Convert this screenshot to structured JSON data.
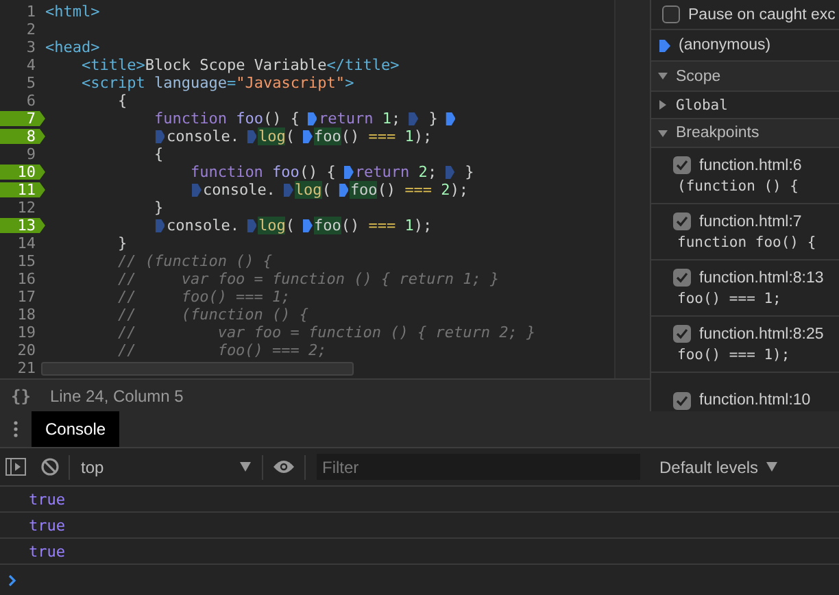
{
  "editor": {
    "lines": [
      {
        "number": "1",
        "breakpoint": false,
        "tokens": [
          {
            "kind": "tag",
            "text": "<html>"
          }
        ]
      },
      {
        "number": "2",
        "breakpoint": false
      },
      {
        "number": "3",
        "breakpoint": false,
        "tokens": [
          {
            "kind": "tag",
            "text": "<head>"
          }
        ],
        "children": [
          {
            "number": "4",
            "breakpoint": false,
            "tokens": [
              {
                "kind": "tag",
                "text": "<title>"
              },
              {
                "kind": "text",
                "text": "Block Scope Variable"
              },
              {
                "kind": "tag",
                "text": "</title>"
              }
            ]
          },
          {
            "number": "5",
            "breakpoint": false,
            "tokens": [
              {
                "kind": "tag",
                "text": "<script"
              },
              {
                "kind": "attr",
                "text": " language"
              },
              {
                "kind": "tag",
                "text": "="
              },
              {
                "kind": "string",
                "text": "\"Javascript\""
              },
              {
                "kind": "tag",
                "text": ">"
              }
            ],
            "children": [
              {
                "number": "6",
                "breakpoint": false,
                "tokens": [
                  {
                    "kind": "text",
                    "text": "{"
                  }
                ],
                "children": [
                  {
                    "number": "7",
                    "breakpoint": true,
                    "tokens": [
                      {
                        "kind": "keyword",
                        "text": "function"
                      },
                      {
                        "kind": "name",
                        "text": " foo"
                      },
                      {
                        "kind": "text",
                        "text": "() {"
                      },
                      {
                        "kind": "marker",
                        "active": true
                      },
                      {
                        "kind": "keyword",
                        "text": "return"
                      },
                      {
                        "kind": "number",
                        "text": " 1"
                      },
                      {
                        "kind": "text",
                        "text": ";"
                      },
                      {
                        "kind": "marker",
                        "active": false
                      },
                      {
                        "kind": "text",
                        "text": " }"
                      },
                      {
                        "kind": "marker",
                        "active": true
                      }
                    ]
                  },
                  {
                    "number": "8",
                    "breakpoint": true,
                    "tokens": [
                      {
                        "kind": "marker",
                        "active": false
                      },
                      {
                        "kind": "text",
                        "text": "console."
                      },
                      {
                        "kind": "marker",
                        "active": false
                      },
                      {
                        "kind": "method",
                        "text": "log",
                        "highlighted": true
                      },
                      {
                        "kind": "text",
                        "text": "("
                      },
                      {
                        "kind": "marker",
                        "active": true
                      },
                      {
                        "kind": "text",
                        "text": "foo",
                        "highlighted": true
                      },
                      {
                        "kind": "text",
                        "text": "() "
                      },
                      {
                        "kind": "operator",
                        "text": "==="
                      },
                      {
                        "kind": "number",
                        "text": " 1"
                      },
                      {
                        "kind": "text",
                        "text": ");"
                      }
                    ]
                  },
                  {
                    "number": "9",
                    "breakpoint": false,
                    "tokens": [
                      {
                        "kind": "text",
                        "text": "{"
                      }
                    ],
                    "children": [
                      {
                        "number": "10",
                        "breakpoint": true,
                        "tokens": [
                          {
                            "kind": "keyword",
                            "text": "function"
                          },
                          {
                            "kind": "name",
                            "text": " foo"
                          },
                          {
                            "kind": "text",
                            "text": "() {"
                          },
                          {
                            "kind": "marker",
                            "active": true
                          },
                          {
                            "kind": "keyword",
                            "text": "return"
                          },
                          {
                            "kind": "number",
                            "text": " 2"
                          },
                          {
                            "kind": "text",
                            "text": ";"
                          },
                          {
                            "kind": "marker",
                            "active": false
                          },
                          {
                            "kind": "text",
                            "text": " }"
                          }
                        ]
                      },
                      {
                        "number": "11",
                        "breakpoint": true,
                        "tokens": [
                          {
                            "kind": "marker",
                            "active": false
                          },
                          {
                            "kind": "text",
                            "text": "console."
                          },
                          {
                            "kind": "marker",
                            "active": false
                          },
                          {
                            "kind": "method",
                            "text": "log",
                            "highlighted": true
                          },
                          {
                            "kind": "text",
                            "text": "("
                          },
                          {
                            "kind": "marker",
                            "active": true
                          },
                          {
                            "kind": "text",
                            "text": "foo",
                            "highlighted": true
                          },
                          {
                            "kind": "text",
                            "text": "() "
                          },
                          {
                            "kind": "operator",
                            "text": "==="
                          },
                          {
                            "kind": "number",
                            "text": " 2"
                          },
                          {
                            "kind": "text",
                            "text": ");"
                          }
                        ]
                      }
                    ]
                  },
                  {
                    "number": "12",
                    "breakpoint": false,
                    "tokens": [
                      {
                        "kind": "text",
                        "text": "}"
                      }
                    ]
                  },
                  {
                    "number": "13",
                    "breakpoint": true,
                    "tokens": [
                      {
                        "kind": "marker",
                        "active": false
                      },
                      {
                        "kind": "text",
                        "text": "console."
                      },
                      {
                        "kind": "marker",
                        "active": false
                      },
                      {
                        "kind": "method",
                        "text": "log",
                        "highlighted": true
                      },
                      {
                        "kind": "text",
                        "text": "("
                      },
                      {
                        "kind": "marker",
                        "active": true
                      },
                      {
                        "kind": "text",
                        "text": "foo",
                        "highlighted": true
                      },
                      {
                        "kind": "text",
                        "text": "() "
                      },
                      {
                        "kind": "operator",
                        "text": "==="
                      },
                      {
                        "kind": "number",
                        "text": " 1"
                      },
                      {
                        "kind": "text",
                        "text": ");"
                      }
                    ]
                  }
                ]
              },
              {
                "number": "14",
                "breakpoint": false,
                "tokens": [
                  {
                    "kind": "text",
                    "text": "}"
                  }
                ]
              },
              {
                "number": "15",
                "breakpoint": false,
                "tokens": [
                  {
                    "kind": "comment",
                    "text": "// (function () {"
                  }
                ]
              },
              {
                "number": "16",
                "breakpoint": false,
                "tokens": [
                  {
                    "kind": "comment",
                    "text": "//     var foo = function () { return 1; }"
                  }
                ]
              },
              {
                "number": "17",
                "breakpoint": false,
                "tokens": [
                  {
                    "kind": "comment",
                    "text": "//     foo() === 1;"
                  }
                ]
              },
              {
                "number": "18",
                "breakpoint": false,
                "tokens": [
                  {
                    "kind": "comment",
                    "text": "//     (function () {"
                  }
                ]
              },
              {
                "number": "19",
                "breakpoint": false,
                "tokens": [
                  {
                    "kind": "comment",
                    "text": "//         var foo = function () { return 2; }"
                  }
                ]
              },
              {
                "number": "20",
                "breakpoint": false,
                "tokens": [
                  {
                    "kind": "comment",
                    "text": "//         foo() === 2;"
                  }
                ]
              }
            ]
          }
        ]
      },
      {
        "number": "21",
        "breakpoint": false
      }
    ]
  },
  "status_bar": {
    "format_button": "{}",
    "text": "Line 24, Column 5"
  },
  "sidebar": {
    "pause_option": {
      "label": "Pause on caught exc",
      "checked": false
    },
    "call_stack": [
      {
        "label": "(anonymous)",
        "selected": true
      }
    ],
    "scope": {
      "title": "Scope",
      "expanded": true,
      "items": [
        {
          "label": "Global",
          "expanded": false
        }
      ]
    },
    "breakpoints": {
      "title": "Breakpoints",
      "expanded": true,
      "items": [
        {
          "location": "function.html:6",
          "snippet": "(function () {",
          "checked": true
        },
        {
          "location": "function.html:7",
          "snippet": "function foo() {",
          "checked": true
        },
        {
          "location": "function.html:8:13",
          "snippet": "foo() === 1;",
          "checked": true
        },
        {
          "location": "function.html:8:25",
          "snippet": "foo() === 1);",
          "checked": true
        },
        {
          "location": "function.html:10",
          "checked": true
        }
      ]
    }
  },
  "console": {
    "tabs": [
      {
        "label": "Console",
        "selected": true
      }
    ],
    "context": "top",
    "filter_placeholder": "Filter",
    "levels": "Default levels",
    "messages": [
      "true",
      "true",
      "true"
    ]
  }
}
